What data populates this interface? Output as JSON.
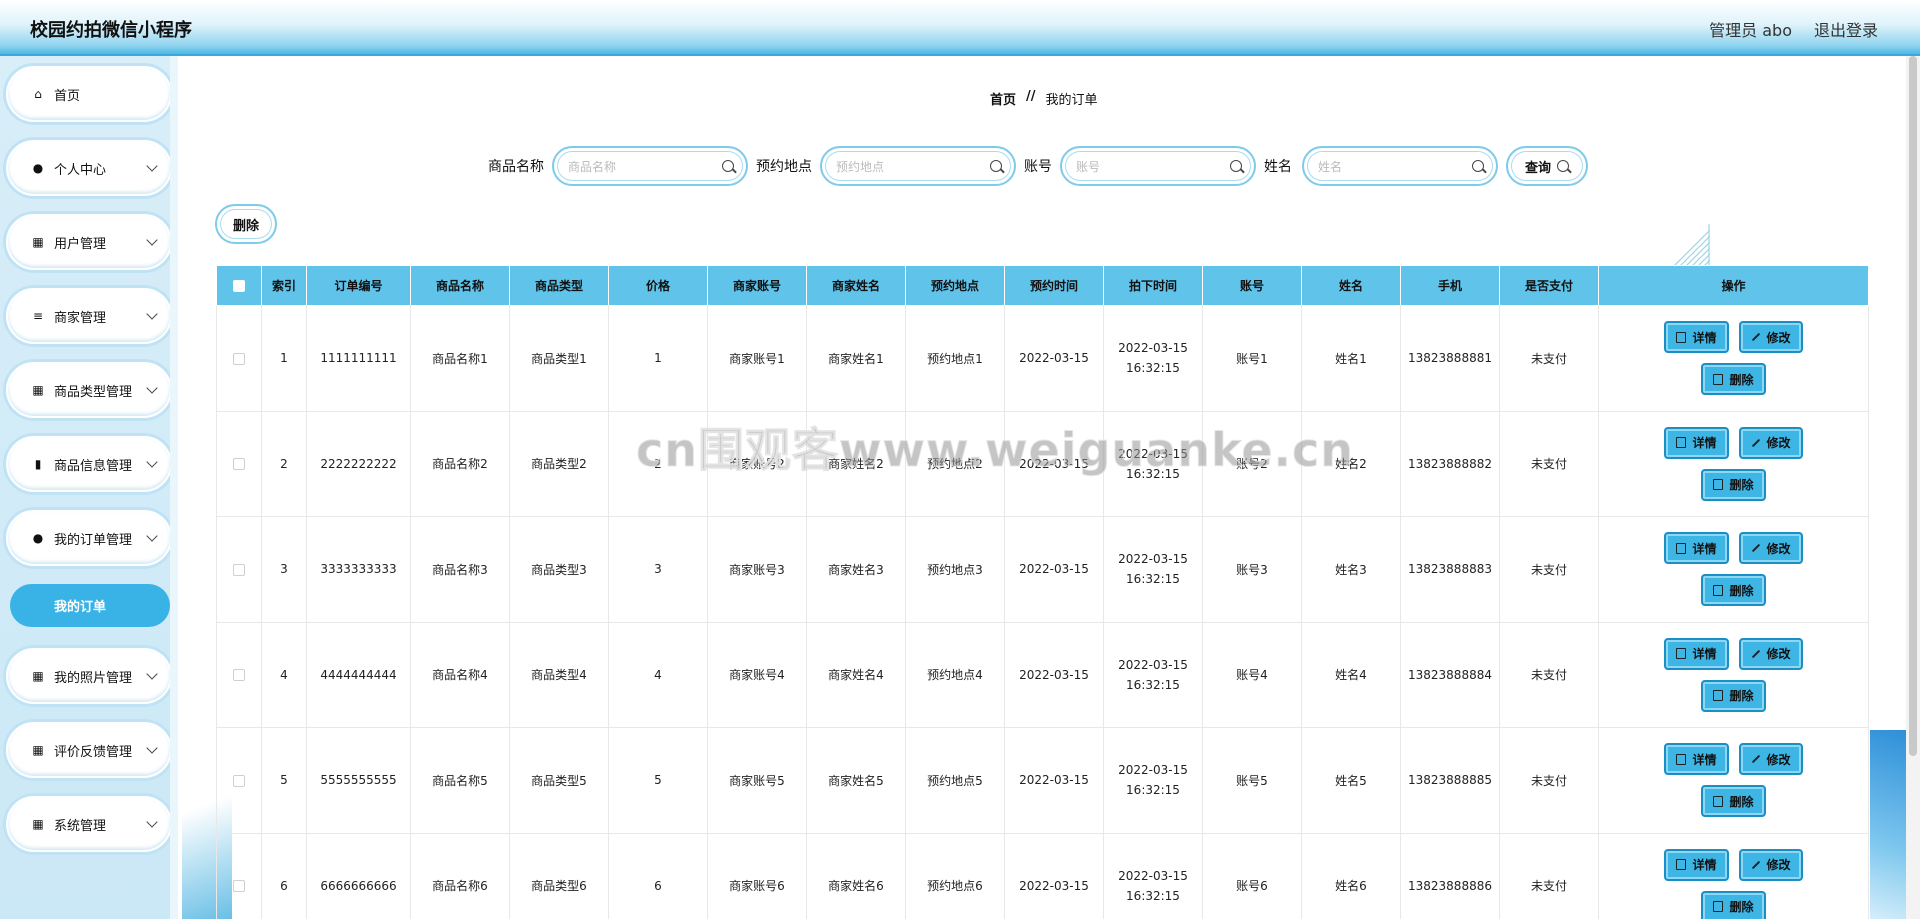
{
  "app": {
    "title": "校园约拍微信小程序"
  },
  "header": {
    "user": "管理员 abo",
    "logout": "退出登录"
  },
  "sidebar": {
    "items": [
      {
        "label": "首页",
        "icon": "home-icon",
        "glyph": "⌂",
        "chevron": false
      },
      {
        "label": "个人中心",
        "icon": "user-icon",
        "glyph": "●",
        "chevron": true
      },
      {
        "label": "用户管理",
        "icon": "grid-icon",
        "glyph": "▦",
        "chevron": true
      },
      {
        "label": "商家管理",
        "icon": "list-icon",
        "glyph": "≡",
        "chevron": true
      },
      {
        "label": "商品类型管理",
        "icon": "grid-icon",
        "glyph": "▦",
        "chevron": true
      },
      {
        "label": "商品信息管理",
        "icon": "chart-icon",
        "glyph": "▮",
        "chevron": true
      },
      {
        "label": "我的订单管理",
        "icon": "user-icon",
        "glyph": "●",
        "chevron": true
      },
      {
        "label": "我的照片管理",
        "icon": "grid-icon",
        "glyph": "▦",
        "chevron": true
      },
      {
        "label": "评价反馈管理",
        "icon": "grid-icon",
        "glyph": "▦",
        "chevron": true
      },
      {
        "label": "系统管理",
        "icon": "grid-icon",
        "glyph": "▦",
        "chevron": true
      }
    ],
    "active_sub": "我的订单"
  },
  "breadcrumb": {
    "home": "首页",
    "sep": "//",
    "current": "我的订单"
  },
  "search": {
    "fields": [
      {
        "label": "商品名称",
        "placeholder": "商品名称"
      },
      {
        "label": "预约地点",
        "placeholder": "预约地点"
      },
      {
        "label": "账号",
        "placeholder": "账号"
      },
      {
        "label": "姓名",
        "placeholder": "姓名"
      }
    ],
    "query_label": "查询"
  },
  "toolbar": {
    "delete_label": "删除"
  },
  "table": {
    "columns": [
      "索引",
      "订单编号",
      "商品名称",
      "商品类型",
      "价格",
      "商家账号",
      "商家姓名",
      "预约地点",
      "预约时间",
      "拍下时间",
      "账号",
      "姓名",
      "手机",
      "是否支付",
      "操作"
    ],
    "rows": [
      [
        "1",
        "1111111111",
        "商品名称1",
        "商品类型1",
        "1",
        "商家账号1",
        "商家姓名1",
        "预约地点1",
        "2022-03-15",
        "2022-03-15 16:32:15",
        "账号1",
        "姓名1",
        "13823888881",
        "未支付"
      ],
      [
        "2",
        "2222222222",
        "商品名称2",
        "商品类型2",
        "2",
        "商家账号2",
        "商家姓名2",
        "预约地点2",
        "2022-03-15",
        "2022-03-15 16:32:15",
        "账号2",
        "姓名2",
        "13823888882",
        "未支付"
      ],
      [
        "3",
        "3333333333",
        "商品名称3",
        "商品类型3",
        "3",
        "商家账号3",
        "商家姓名3",
        "预约地点3",
        "2022-03-15",
        "2022-03-15 16:32:15",
        "账号3",
        "姓名3",
        "13823888883",
        "未支付"
      ],
      [
        "4",
        "4444444444",
        "商品名称4",
        "商品类型4",
        "4",
        "商家账号4",
        "商家姓名4",
        "预约地点4",
        "2022-03-15",
        "2022-03-15 16:32:15",
        "账号4",
        "姓名4",
        "13823888884",
        "未支付"
      ],
      [
        "5",
        "5555555555",
        "商品名称5",
        "商品类型5",
        "5",
        "商家账号5",
        "商家姓名5",
        "预约地点5",
        "2022-03-15",
        "2022-03-15 16:32:15",
        "账号5",
        "姓名5",
        "13823888885",
        "未支付"
      ],
      [
        "6",
        "6666666666",
        "商品名称6",
        "商品类型6",
        "6",
        "商家账号6",
        "商家姓名6",
        "预约地点6",
        "2022-03-15",
        "2022-03-15 16:32:15",
        "账号6",
        "姓名6",
        "13823888886",
        "未支付"
      ]
    ],
    "actions": {
      "detail": "详情",
      "edit": "修改",
      "delete": "删除"
    }
  },
  "watermark": "cn围观客www.weiguanke.cn",
  "colors": {
    "accent": "#39b3e6",
    "header_th": "#5fc3ea",
    "button_border": "#1a8fc4"
  }
}
